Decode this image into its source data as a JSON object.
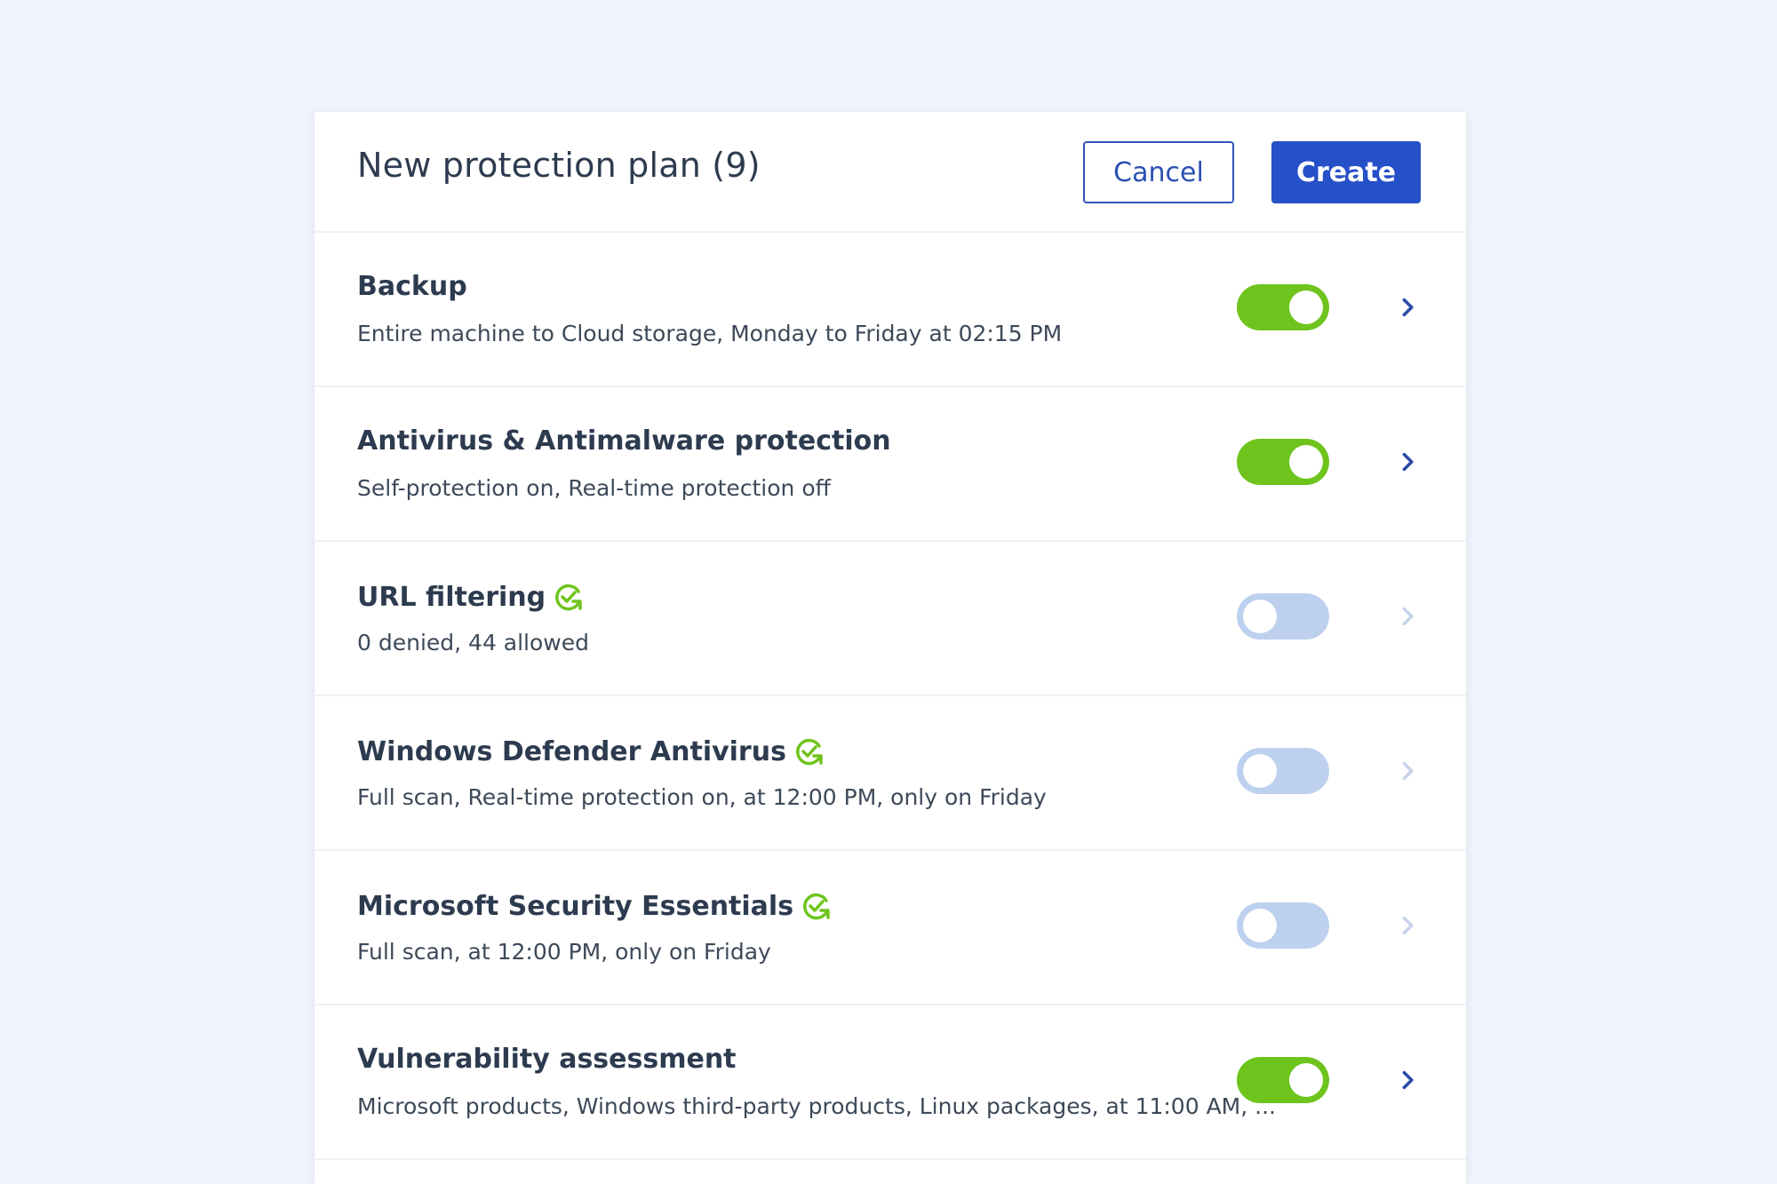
{
  "header": {
    "title": "New protection plan (9)",
    "cancel_label": "Cancel",
    "create_label": "Create"
  },
  "colors": {
    "page_bg": "#f1f4fb",
    "accent_blue": "#2550c8",
    "toggle_on": "#6ec41c",
    "toggle_off": "#bdd0ee",
    "chevron_active": "#2c4aa8",
    "chevron_inactive": "#c7d3ea",
    "sync_icon": "#6ec41c"
  },
  "modules": [
    {
      "name": "Backup",
      "description": "Entire machine to Cloud storage, Monday to Friday at 02:15 PM",
      "enabled": true,
      "sync_icon": false
    },
    {
      "name": "Antivirus & Antimalware protection",
      "description": "Self-protection on, Real-time protection off",
      "enabled": true,
      "sync_icon": false
    },
    {
      "name": "URL filtering",
      "description": "0 denied, 44 allowed",
      "enabled": false,
      "sync_icon": true
    },
    {
      "name": "Windows Defender Antivirus",
      "description": "Full scan, Real-time protection on, at 12:00 PM, only on Friday",
      "enabled": false,
      "sync_icon": true
    },
    {
      "name": "Microsoft Security Essentials",
      "description": "Full scan, at 12:00 PM, only on Friday",
      "enabled": false,
      "sync_icon": true
    },
    {
      "name": "Vulnerability assessment",
      "description": "Microsoft products, Windows third-party products, Linux packages, at 11:00 AM, ...",
      "enabled": true,
      "sync_icon": false
    }
  ]
}
